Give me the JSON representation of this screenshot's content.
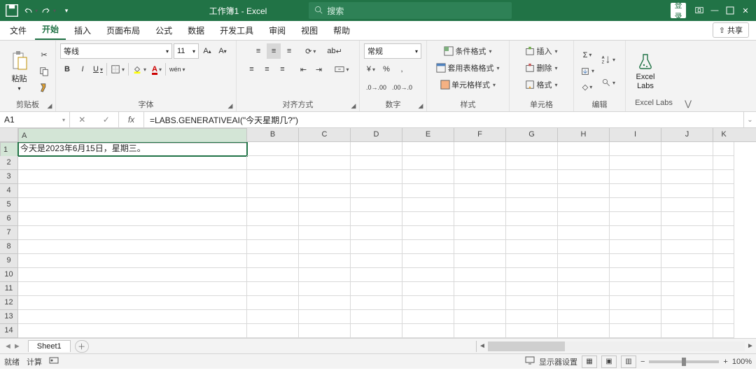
{
  "title": {
    "doc": "工作簿1",
    "app": "Excel",
    "full": "工作簿1  -  Excel"
  },
  "search": {
    "placeholder": "搜索"
  },
  "login": {
    "label": "登录"
  },
  "tabs": {
    "file": "文件",
    "home": "开始",
    "insert": "插入",
    "layout": "页面布局",
    "formulas": "公式",
    "data": "数据",
    "dev": "开发工具",
    "review": "审阅",
    "view": "视图",
    "help": "帮助"
  },
  "share": {
    "label": "共享"
  },
  "ribbon": {
    "clipboard": {
      "paste": "粘贴",
      "label": "剪贴板"
    },
    "font": {
      "name": "等线",
      "size": "11",
      "bold": "B",
      "italic": "I",
      "underline": "U",
      "wen": "wén",
      "label": "字体"
    },
    "align": {
      "wrap": "ab",
      "label": "对齐方式"
    },
    "number": {
      "format": "常规",
      "label": "数字"
    },
    "styles": {
      "cond": "条件格式",
      "table": "套用表格格式",
      "cell": "单元格样式",
      "label": "样式"
    },
    "cells": {
      "insert": "插入",
      "delete": "删除",
      "format": "格式",
      "label": "单元格"
    },
    "editing": {
      "label": "编辑"
    },
    "labs": {
      "name": "Excel\nLabs",
      "label": "Excel Labs"
    }
  },
  "formula_bar": {
    "cell_ref": "A1",
    "fx": "fx",
    "formula": "=LABS.GENERATIVEAI(\"今天星期几?\")"
  },
  "grid": {
    "columns": [
      "A",
      "B",
      "C",
      "D",
      "E",
      "F",
      "G",
      "H",
      "I",
      "J",
      "K"
    ],
    "rows": 14,
    "active": "A1",
    "cells": {
      "A1": "今天是2023年6月15日，星期三。"
    }
  },
  "sheets": {
    "items": [
      "Sheet1"
    ],
    "active": 0
  },
  "status": {
    "ready": "就绪",
    "calc": "计算",
    "display": "显示器设置",
    "zoom": "100%"
  }
}
